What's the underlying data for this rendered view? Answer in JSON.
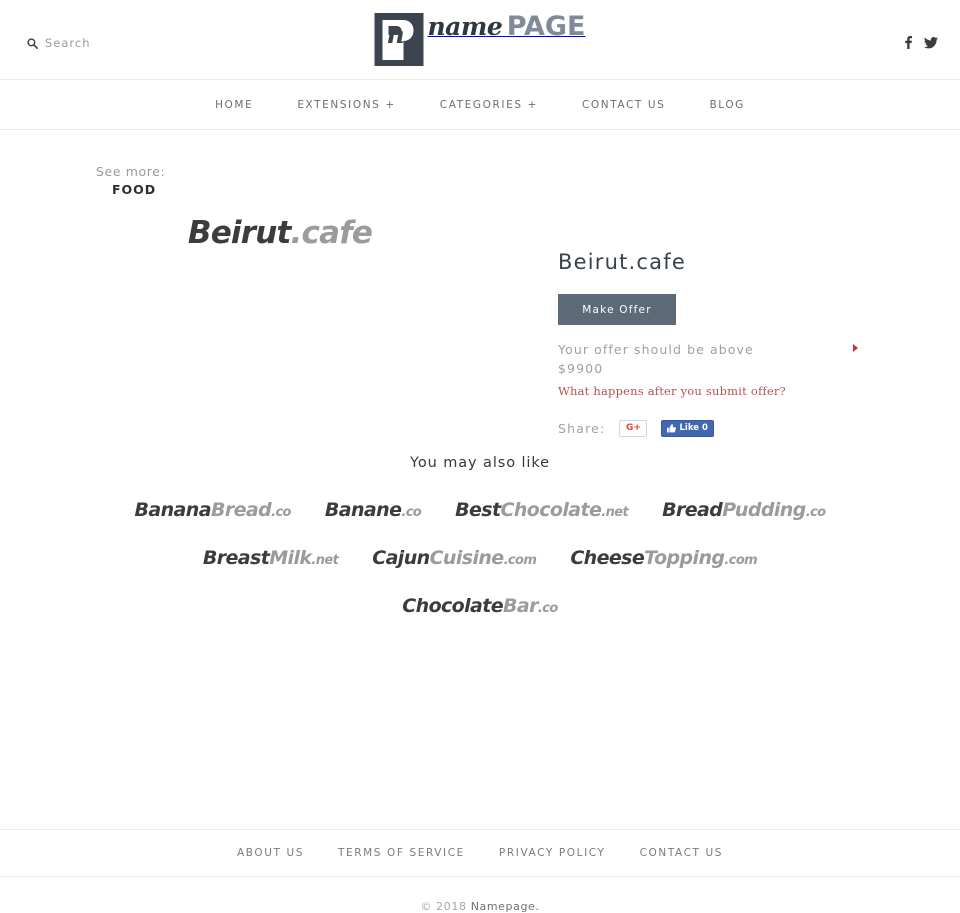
{
  "header": {
    "search": {
      "label": "Search",
      "icon": "search-icon"
    },
    "logo": {
      "mark_letter": "n",
      "name": "name",
      "page": "PAGE"
    },
    "social": [
      {
        "name": "facebook-icon",
        "label": "f"
      },
      {
        "name": "twitter-icon",
        "label": "t"
      }
    ]
  },
  "nav": {
    "items": [
      {
        "label": "HOME"
      },
      {
        "label": "EXTENSIONS +"
      },
      {
        "label": "CATEGORIES +"
      },
      {
        "label": "CONTACT US"
      },
      {
        "label": "BLOG"
      }
    ]
  },
  "breadcrumb": {
    "see_more_label": "See more:",
    "category": "FOOD"
  },
  "hero": {
    "domain_name": "Beirut",
    "domain_tld": ".cafe"
  },
  "detail": {
    "title": "Beirut.cafe",
    "make_offer_label": "Make Offer",
    "offer_note": "Your offer should be above $9900",
    "offer_minimum": "$9900",
    "offer_link": "What happens after you submit offer?",
    "share_label": "Share:",
    "gplus_label": "G+",
    "fb_like_label": "Like",
    "fb_like_count": "0"
  },
  "also_like": {
    "title": "You may also like",
    "items": [
      {
        "first": "Banana",
        "second": "Bread",
        "tld": ".co"
      },
      {
        "first": "Banane",
        "second": "",
        "tld": ".co"
      },
      {
        "first": "Best",
        "second": "Chocolate",
        "tld": ".net"
      },
      {
        "first": "Bread",
        "second": "Pudding",
        "tld": ".co"
      },
      {
        "first": "Breast",
        "second": "Milk",
        "tld": ".net"
      },
      {
        "first": "Cajun",
        "second": "Cuisine",
        "tld": ".com"
      },
      {
        "first": "Cheese",
        "second": "Topping",
        "tld": ".com"
      },
      {
        "first": "Chocolate",
        "second": "Bar",
        "tld": ".co"
      }
    ]
  },
  "footer": {
    "links": [
      {
        "label": "ABOUT US"
      },
      {
        "label": "TERMS OF SERVICE"
      },
      {
        "label": "PRIVACY POLICY"
      },
      {
        "label": "CONTACT US"
      }
    ],
    "copyright_prefix": "© 2018",
    "copyright_brand": "Namepage."
  },
  "colors": {
    "accent_button": "#5d6a78",
    "link_red": "#b5514f",
    "logo_dark": "#3b444f",
    "logo_light": "#7f8b98",
    "facebook_blue": "#4267b2",
    "gplus_red": "#dd4b39"
  }
}
